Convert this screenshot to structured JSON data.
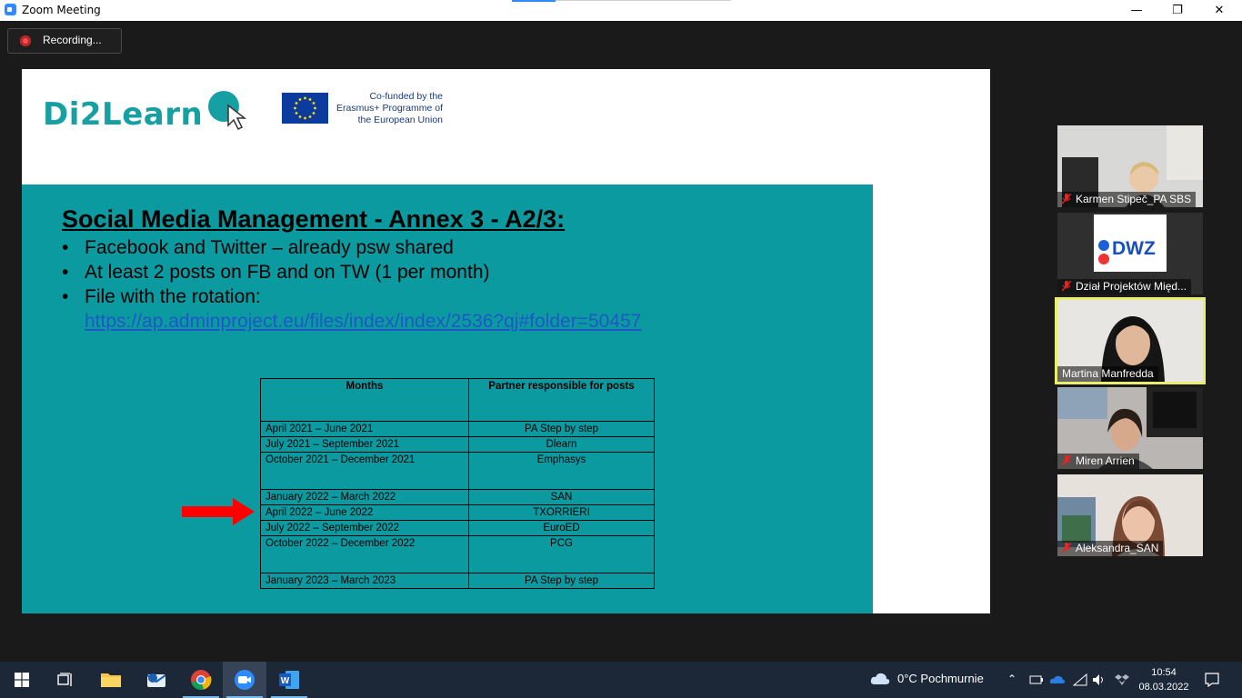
{
  "window": {
    "title": "Zoom Meeting",
    "minimize_glyph": "—",
    "maximize_glyph": "❐",
    "close_glyph": "✕"
  },
  "recording": {
    "label": "Recording..."
  },
  "slide": {
    "logo_text": "Di2Learn",
    "eu_text": "Co-funded by the Erasmus+ Programme of the European Union",
    "title": "Social Media Management - Annex 3 - A2/3:",
    "bullets": [
      "Facebook and Twitter – already psw shared",
      "At least 2 posts on FB and on TW (1 per month)",
      "File with the rotation:"
    ],
    "link": "https://ap.adminproject.eu/files/index/index/2536?qj#folder=50457",
    "table": {
      "headers": [
        "Months",
        "Partner responsible for posts"
      ],
      "rows": [
        [
          "April 2021 – June 2021",
          "PA Step by step"
        ],
        [
          "July 2021 – September 2021",
          "Dlearn"
        ],
        [
          "October 2021 – December 2021",
          "Emphasys"
        ],
        [
          "January 2022 – March 2022",
          "SAN"
        ],
        [
          "April 2022 – June 2022",
          "TXORRIERI"
        ],
        [
          "July 2022 – September 2022",
          "EuroED"
        ],
        [
          "October 2022 – December 2022",
          "PCG"
        ],
        [
          "January 2023 – March 2023",
          "PA Step by step"
        ]
      ]
    }
  },
  "participants": [
    {
      "name": "Karmen Stipeč_PA SBS",
      "muted": true,
      "active": false
    },
    {
      "name": "Dział Projektów Międ...",
      "muted": true,
      "active": false,
      "logo_text": "DWZ"
    },
    {
      "name": "Martina Manfredda",
      "muted": false,
      "active": true
    },
    {
      "name": "Miren Arrien",
      "muted": true,
      "active": false
    },
    {
      "name": "Aleksandra_SAN",
      "muted": true,
      "active": false
    }
  ],
  "taskbar": {
    "apps": [
      "start-icon",
      "task-view-icon",
      "file-explorer-icon",
      "mail-icon",
      "chrome-icon",
      "zoom-icon",
      "word-icon"
    ],
    "weather": "0°C  Pochmurnie",
    "time": "10:54",
    "date": "08.03.2022"
  }
}
